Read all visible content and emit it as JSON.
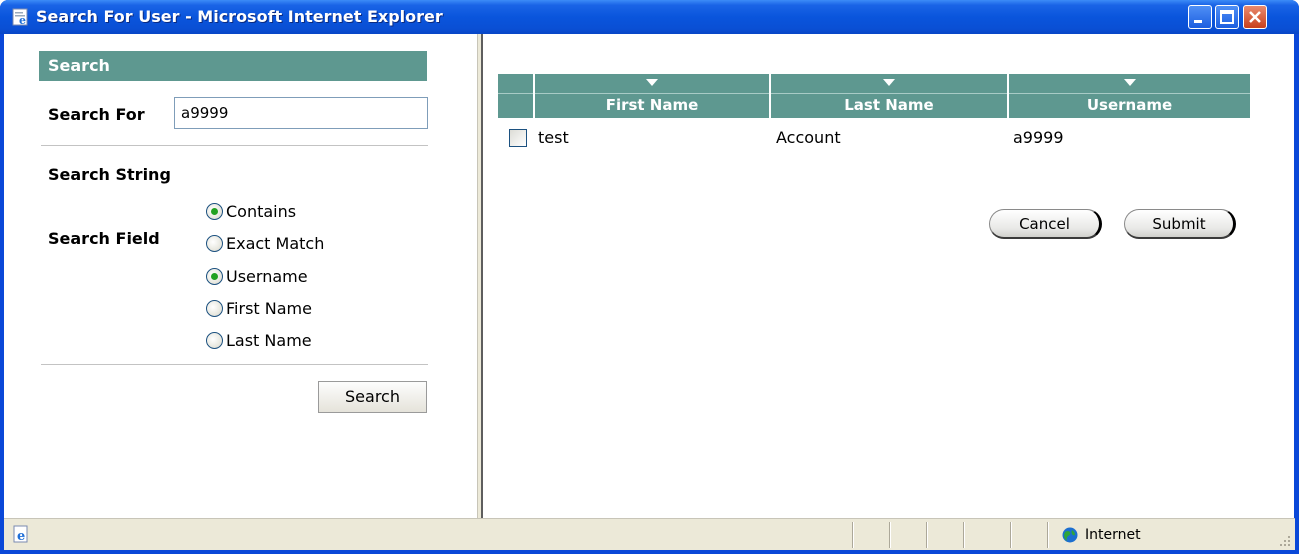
{
  "window": {
    "title": "Search For User - Microsoft Internet Explorer",
    "icon": "ie-page-icon",
    "controls": [
      "minimize-icon",
      "maximize-icon",
      "close-icon"
    ]
  },
  "search_panel": {
    "header": "Search",
    "search_for_label": "Search For",
    "search_for_value": "a9999",
    "search_string_label": "Search String",
    "search_string_options": [
      {
        "label": "Contains",
        "checked": true
      },
      {
        "label": "Exact Match",
        "checked": false
      }
    ],
    "search_field_label": "Search Field",
    "search_field_options": [
      {
        "label": "Username",
        "checked": true
      },
      {
        "label": "First Name",
        "checked": false
      },
      {
        "label": "Last Name",
        "checked": false
      }
    ],
    "search_button": "Search"
  },
  "results": {
    "columns": [
      "First Name",
      "Last Name",
      "Username"
    ],
    "rows": [
      {
        "checked": false,
        "first_name": "test",
        "last_name": "Account",
        "username": "a9999"
      }
    ],
    "cancel_button": "Cancel",
    "submit_button": "Submit"
  },
  "statusbar": {
    "zone": "Internet",
    "zone_icon": "globe-icon"
  },
  "colors": {
    "title_bar": "#0a55dc",
    "header_teal": "#5e9890",
    "radio_dot": "#21a121"
  }
}
